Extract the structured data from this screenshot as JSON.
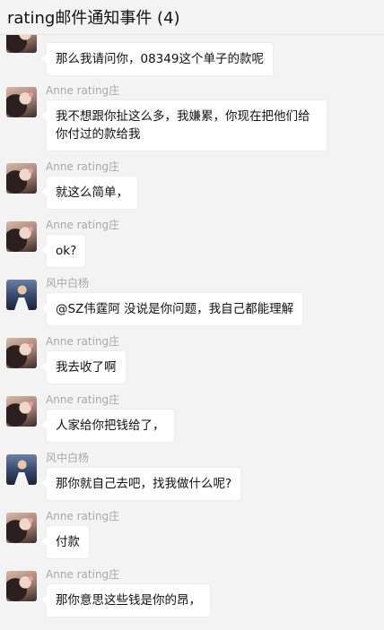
{
  "header": {
    "title": "rating邮件通知事件 (4)"
  },
  "messages": [
    {
      "sender": "",
      "avatar": "anne-avatar",
      "text": "那么我请问你，08349这个单子的款呢"
    },
    {
      "sender": "Anne rating庄",
      "avatar": "anne-avatar",
      "text": "我不想跟你扯这么多，我嫌累，你现在把他们给你付过的款给我"
    },
    {
      "sender": "Anne rating庄",
      "avatar": "anne-avatar",
      "text": " 就这么简单，"
    },
    {
      "sender": "Anne rating庄",
      "avatar": "anne-avatar",
      "text": "ok?"
    },
    {
      "sender": "风中白杨",
      "avatar": "wind-avatar",
      "text": "@SZ伟霆阿 没说是你问题，我自己都能理解"
    },
    {
      "sender": "Anne rating庄",
      "avatar": "anne-avatar",
      "text": "我去收了啊"
    },
    {
      "sender": "Anne rating庄",
      "avatar": "anne-avatar",
      "text": "人家给你把钱给了，"
    },
    {
      "sender": "风中白杨",
      "avatar": "wind-avatar",
      "text": "那你就自己去吧，找我做什么呢?"
    },
    {
      "sender": "Anne rating庄",
      "avatar": "anne-avatar",
      "text": "付款"
    },
    {
      "sender": "Anne rating庄",
      "avatar": "anne-avatar",
      "text": "那你意思这些钱是你的昂，"
    }
  ]
}
